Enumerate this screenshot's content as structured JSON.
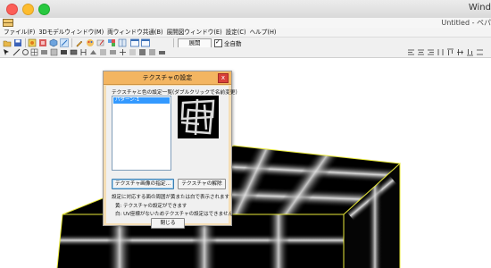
{
  "window": {
    "title": "Wind",
    "document_title": "Untitled - ペパ"
  },
  "menubar": {
    "items": [
      "ファイル(F)",
      "3Dモデルウィンドウ(M)",
      "両ウィンドウ共通(B)",
      "展開図ウィンドウ(E)",
      "設定(C)",
      "ヘルプ(H)"
    ]
  },
  "toolbar": {
    "expand_label": "展開",
    "auto_expand_label": "全自動",
    "auto_expand_checked": true
  },
  "dialog": {
    "title": "テクスチャの設定",
    "close_glyph": "x",
    "list_label": "テクスチャと色の設定一覧(ダブルクリックで名前変更)",
    "list_items": [
      "パターン-1"
    ],
    "selected_index": 0,
    "specify_button": "テクスチャ画像の指定...",
    "release_button": "テクスチャの解除",
    "notes": [
      "設定に対応する面の周囲が黄または白で表示されます",
      "黄: テクスチャの設定ができます",
      "白: UV座標がないためテクスチャの設定はできません"
    ],
    "close_button": "閉じる"
  },
  "colors": {
    "dialog_title_bar": "#f3b561",
    "dialog_background": "#f5deb5",
    "selection": "#3399ff",
    "model_face": "#000000",
    "model_edge": "#e8e83a"
  },
  "icons": {
    "toolbar_row1": [
      "open-folder-icon",
      "save-icon",
      "texture-icon",
      "model-icon",
      "cube-icon",
      "view-icon",
      "pencil-icon",
      "palette-icon",
      "edit-icon",
      "window-icon",
      "window2-icon"
    ],
    "toolbar_row2": [
      "select-icon",
      "line-icon",
      "rotate-icon",
      "grid-icon",
      "text-icon",
      "move-icon",
      "zoom-icon",
      "layer-icon",
      "cut-icon",
      "fold-icon",
      "edge-icon",
      "tab-icon",
      "flip-icon",
      "list-icon"
    ]
  }
}
